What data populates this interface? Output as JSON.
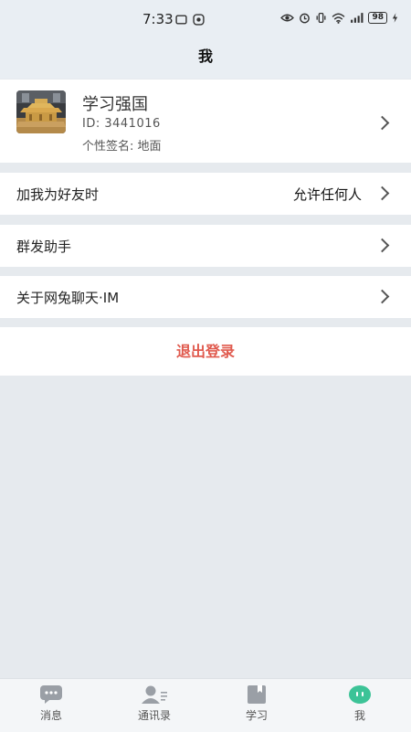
{
  "status_bar": {
    "time": "7:33",
    "battery": "98"
  },
  "header": {
    "title": "我"
  },
  "profile": {
    "name": "学习强国",
    "id_text": "ID:  3441016",
    "signature_text": "个性签名:  地面"
  },
  "settings": {
    "friend_label": "加我为好友时",
    "friend_value": "允许任何人",
    "group_send_label": "群发助手",
    "about_label": "关于网兔聊天·IM"
  },
  "logout_label": "退出登录",
  "tabbar": {
    "items": [
      {
        "label": "消息",
        "icon": "chat-bubble-icon"
      },
      {
        "label": "通讯录",
        "icon": "contacts-icon"
      },
      {
        "label": "学习",
        "icon": "book-icon"
      },
      {
        "label": "我",
        "icon": "face-icon"
      }
    ]
  },
  "colors": {
    "accent_green": "#3cc397",
    "logout_red": "#e05a4e",
    "page_bg": "#e6eaee",
    "tab_icon_gray": "#9a9fa6"
  }
}
